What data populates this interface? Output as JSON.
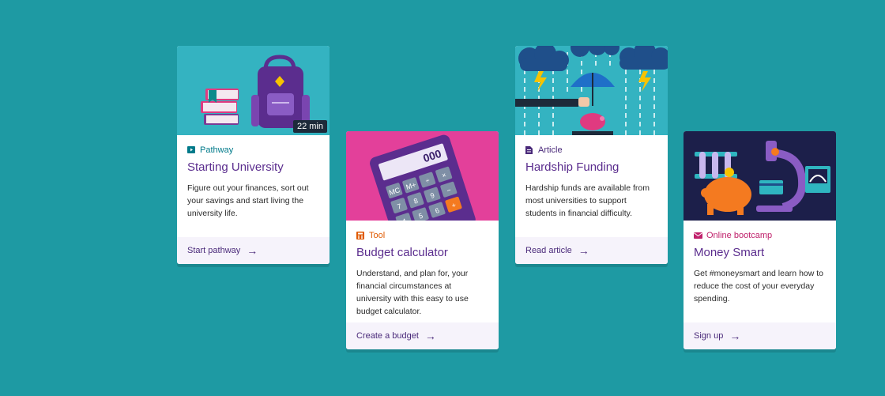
{
  "cards": [
    {
      "tag": "Pathway",
      "tag_color": "#007a8a",
      "title": "Starting University",
      "desc": "Figure out your finances, sort out your savings and start living the university life.",
      "duration": "22 min",
      "cta": "Start pathway",
      "image_bg": "#34b3c1",
      "icon": "video-icon"
    },
    {
      "tag": "Tool",
      "tag_color": "#e05a00",
      "title": "Budget calculator",
      "desc": "Understand, and plan for, your financial circumstances at university with this easy to use budget calculator.",
      "cta": "Create a budget",
      "image_bg": "#e3409a",
      "icon": "calculator-icon",
      "calculator_display": "000",
      "calculator_keys": [
        "MC",
        "M+",
        "÷",
        "×",
        "7",
        "8",
        "9",
        "−",
        "4",
        "5",
        "6",
        "+"
      ]
    },
    {
      "tag": "Article",
      "tag_color": "#4a2a7a",
      "title": "Hardship Funding",
      "desc": "Hardship funds are available from most universities to support students in financial difficulty.",
      "cta": "Read article",
      "image_bg": "#34b3c1",
      "icon": "article-icon"
    },
    {
      "tag": "Online bootcamp",
      "tag_color": "#c0226c",
      "title": "Money Smart",
      "desc": "Get #moneysmart and learn how to reduce the cost of your everyday spending.",
      "cta": "Sign up",
      "image_bg": "#1c1f4a",
      "icon": "envelope-icon"
    }
  ],
  "arrow": "→"
}
